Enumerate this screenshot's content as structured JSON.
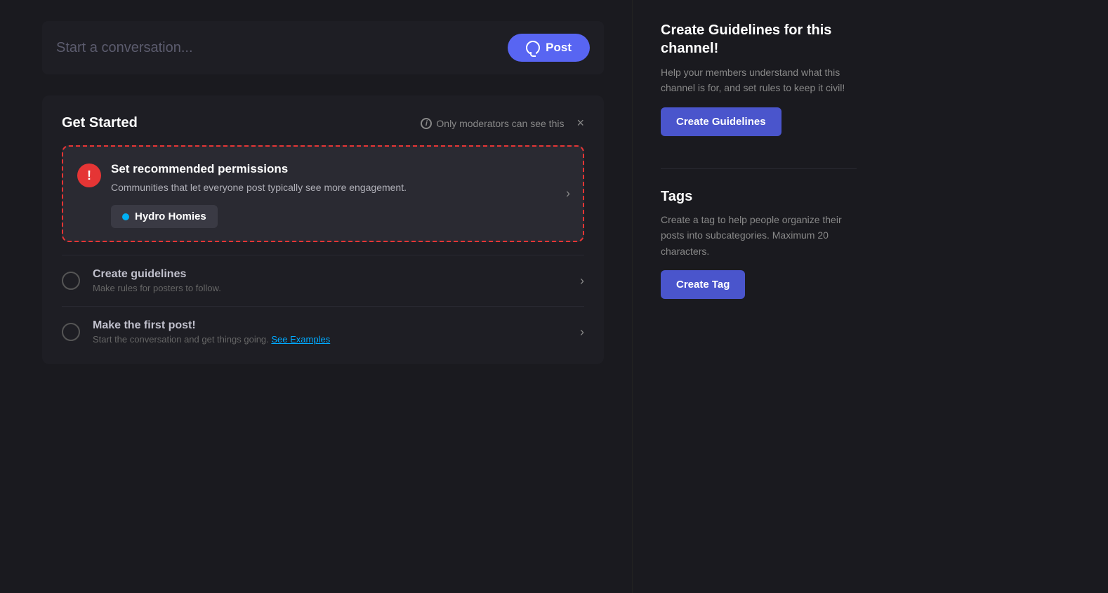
{
  "post_bar": {
    "placeholder": "Start a conversation...",
    "button_label": "Post"
  },
  "get_started": {
    "title": "Get Started",
    "moderator_note": "Only moderators can see this",
    "close_label": "×"
  },
  "permissions_card": {
    "title": "Set recommended permissions",
    "description": "Communities that let everyone post typically see more engagement.",
    "community_name": "Hydro Homies"
  },
  "list_items": [
    {
      "id": "guidelines",
      "title": "Create guidelines",
      "description": "Make rules for posters to follow.",
      "see_examples_link": null
    },
    {
      "id": "first_post",
      "title": "Make the first post!",
      "description": "Start the conversation and get things going.",
      "see_examples_link": "See Examples"
    }
  ],
  "right_panel": {
    "guidelines": {
      "title": "Create Guidelines for this channel!",
      "description": "Help your members understand what this channel is for, and set rules to keep it civil!",
      "button_label": "Create Guidelines"
    },
    "tags": {
      "title": "Tags",
      "description": "Create a tag to help people organize their posts into subcategories. Maximum 20 characters.",
      "button_label": "Create Tag"
    }
  }
}
